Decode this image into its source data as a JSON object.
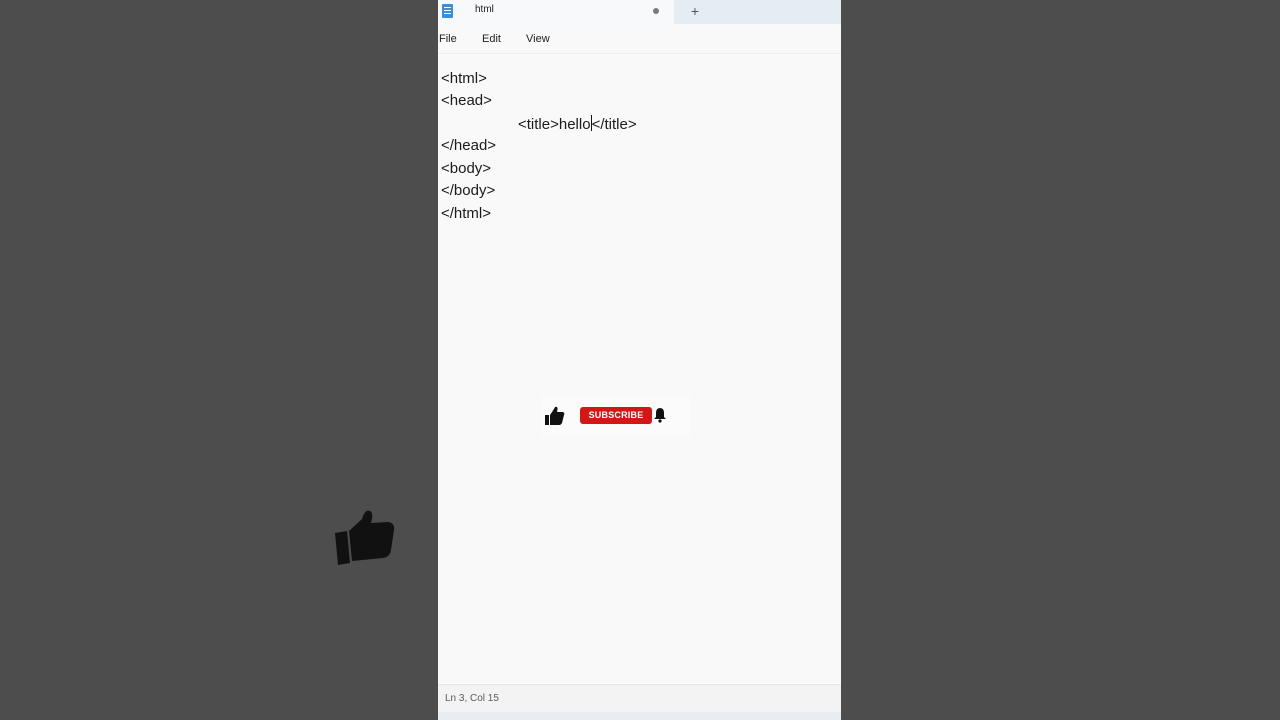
{
  "tab": {
    "title": "html",
    "new_tab_symbol": "+"
  },
  "menu": {
    "file": "File",
    "edit": "Edit",
    "view": "View"
  },
  "editor": {
    "lines": [
      "<html>",
      "<head>",
      "<title>hello",
      "</title>",
      "</head>",
      "<body>",
      "</body>",
      "</html>"
    ]
  },
  "status": {
    "position": "Ln 3, Col 15"
  },
  "overlay": {
    "subscribe_label": "SUBSCRIBE",
    "accent_color": "#d21717"
  },
  "icons": {
    "app": "notepad-icon",
    "like": "thumbs-up-icon",
    "bell": "bell-icon"
  }
}
